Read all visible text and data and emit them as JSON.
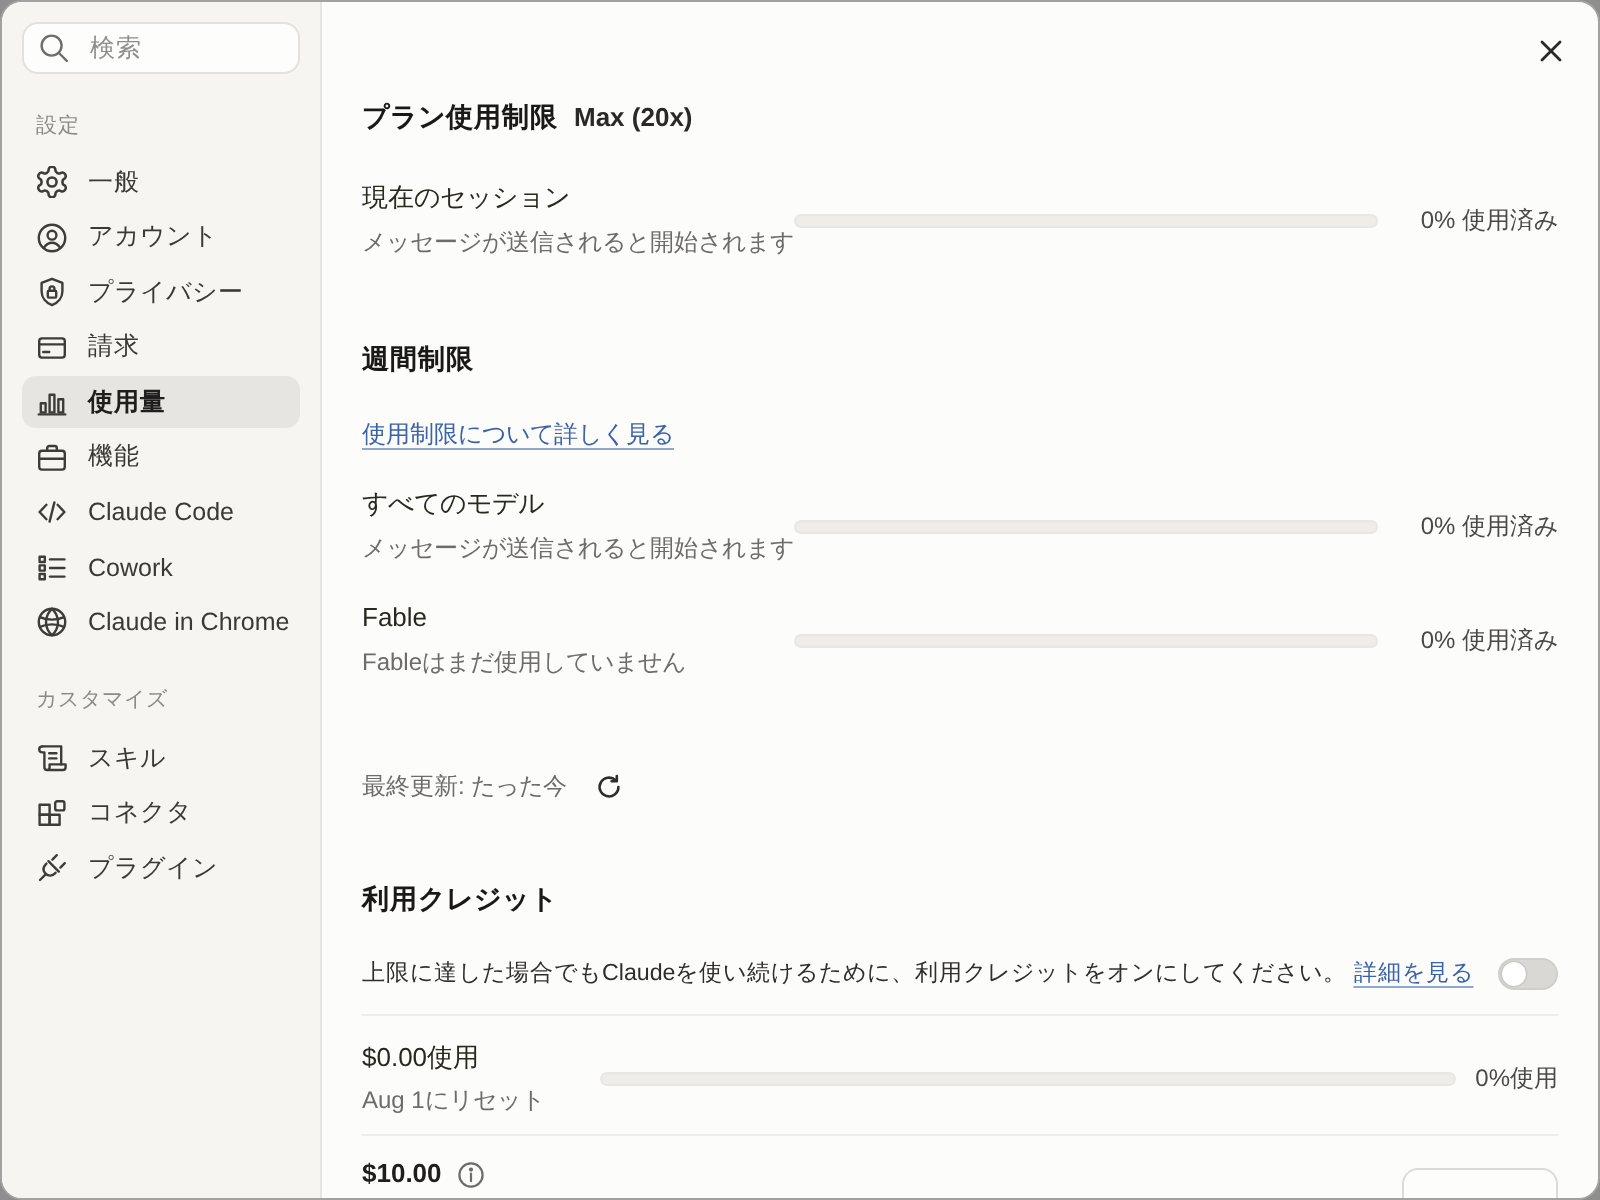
{
  "search": {
    "placeholder": "検索"
  },
  "sidebar": {
    "sections": [
      {
        "title": "設定",
        "items": [
          {
            "label": "一般",
            "selected": false
          },
          {
            "label": "アカウント",
            "selected": false
          },
          {
            "label": "プライバシー",
            "selected": false
          },
          {
            "label": "請求",
            "selected": false
          },
          {
            "label": "使用量",
            "selected": true
          },
          {
            "label": "機能",
            "selected": false
          },
          {
            "label": "Claude Code",
            "selected": false
          },
          {
            "label": "Cowork",
            "selected": false
          },
          {
            "label": "Claude in Chrome",
            "selected": false
          }
        ]
      },
      {
        "title": "カスタマイズ",
        "items": [
          {
            "label": "スキル",
            "selected": false
          },
          {
            "label": "コネクタ",
            "selected": false
          },
          {
            "label": "プラグイン",
            "selected": false
          }
        ]
      }
    ]
  },
  "plan": {
    "title": "プラン使用制限",
    "plan_name": "Max (20x)",
    "rows": [
      {
        "name": "現在のセッション",
        "description": "メッセージが送信されると開始されます",
        "level": 0,
        "reading": "0% 使用済み"
      }
    ]
  },
  "weekly": {
    "title": "週間制限",
    "link": "使用制限について詳しく見る",
    "rows": [
      {
        "name": "すべてのモデル",
        "description": "メッセージが送信されると開始されます",
        "level": 0,
        "reading": "0% 使用済み"
      },
      {
        "name": "Fable",
        "description": "Fableはまだ使用していません",
        "level": 0,
        "reading": "0% 使用済み"
      }
    ]
  },
  "last_updated": "最終更新: たった今",
  "credits": {
    "title": "利用クレジット",
    "description": "上限に達した場合でもClaudeを使い続けるために、利用クレジットをオンにしてください。",
    "link": "詳細を見る",
    "on": false,
    "usage": {
      "amount": "$0.00使用",
      "reset": "Aug 1にリセット",
      "level": 0,
      "reading": "0%使用"
    },
    "limit": "$10.00"
  }
}
